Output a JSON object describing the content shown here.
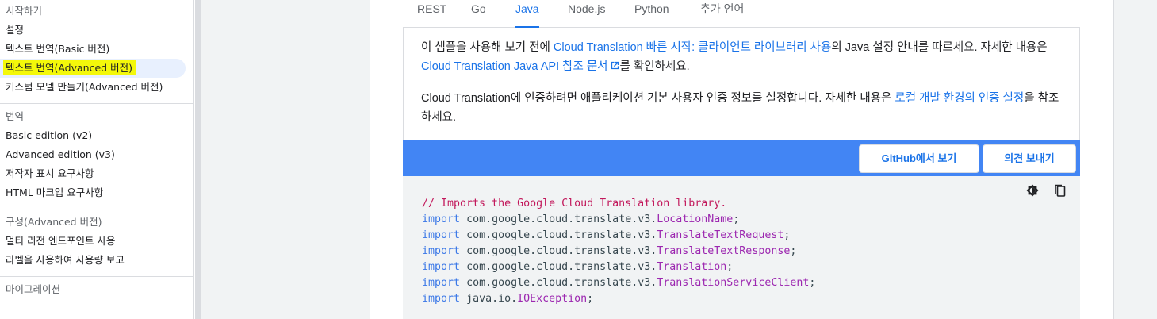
{
  "sidebar": {
    "sections": [
      {
        "heading": "시작하기",
        "items": [
          {
            "label": "설정",
            "active": false
          },
          {
            "label": "텍스트 번역(Basic 버전)",
            "active": false
          },
          {
            "label": "텍스트 번역(Advanced 버전)",
            "active": true
          },
          {
            "label": "커스텀 모델 만들기(Advanced 버전)",
            "active": false
          }
        ]
      },
      {
        "heading": "번역",
        "items": [
          {
            "label": "Basic edition (v2)",
            "active": false
          },
          {
            "label": "Advanced edition (v3)",
            "active": false
          },
          {
            "label": "저작자 표시 요구사항",
            "active": false
          },
          {
            "label": "HTML 마크업 요구사항",
            "active": false
          }
        ]
      },
      {
        "heading": "구성(Advanced 버전)",
        "items": [
          {
            "label": "멀티 리전 엔드포인트 사용",
            "active": false
          },
          {
            "label": "라벨을 사용하여 사용량 보고",
            "active": false
          }
        ]
      },
      {
        "heading": "마이그레이션",
        "items": []
      }
    ]
  },
  "tabs": [
    {
      "label": "REST",
      "active": false
    },
    {
      "label": "Go",
      "active": false
    },
    {
      "label": "Java",
      "active": true
    },
    {
      "label": "Node.js",
      "active": false
    },
    {
      "label": "Python",
      "active": false
    },
    {
      "label": "추가 언어",
      "active": false
    }
  ],
  "content": {
    "p1": {
      "t1": "이 샘플을 사용해 보기 전에 ",
      "link1": "Cloud Translation 빠른 시작: 클라이언트 라이브러리 사용",
      "t2": "의 Java 설정 안내를 따르세요. 자세한 내용은 ",
      "link2": "Cloud Translation Java API 참조 문서",
      "t3": "를 확인하세요."
    },
    "p2": {
      "t1": "Cloud Translation에 인증하려면 애플리케이션 기본 사용자 인증 정보를 설정합니다. 자세한 내용은 ",
      "link1": "로컬 개발 환경의 인증 설정",
      "t2": "을 참조하세요."
    }
  },
  "toolbar": {
    "github_label": "GitHub에서 보기",
    "feedback_label": "의견 보내기"
  },
  "code": {
    "icons": [
      "dark-mode-icon",
      "copy-icon"
    ],
    "comment": "// Imports the Google Cloud Translation library.",
    "keyword": "import",
    "package": "com.google.cloud.translate.v3.",
    "imports": [
      {
        "pkg": "com.google.cloud.translate.v3.",
        "cls": "LocationName"
      },
      {
        "pkg": "com.google.cloud.translate.v3.",
        "cls": "TranslateTextRequest"
      },
      {
        "pkg": "com.google.cloud.translate.v3.",
        "cls": "TranslateTextResponse"
      },
      {
        "pkg": "com.google.cloud.translate.v3.",
        "cls": "Translation"
      },
      {
        "pkg": "com.google.cloud.translate.v3.",
        "cls": "TranslationServiceClient"
      },
      {
        "pkg": "java.io.",
        "cls": "IOException"
      }
    ]
  },
  "colors": {
    "accent": "#1a73e8",
    "bar": "#4285f4",
    "highlight": "#f4f80a",
    "code_bg": "#f1f3f4"
  }
}
